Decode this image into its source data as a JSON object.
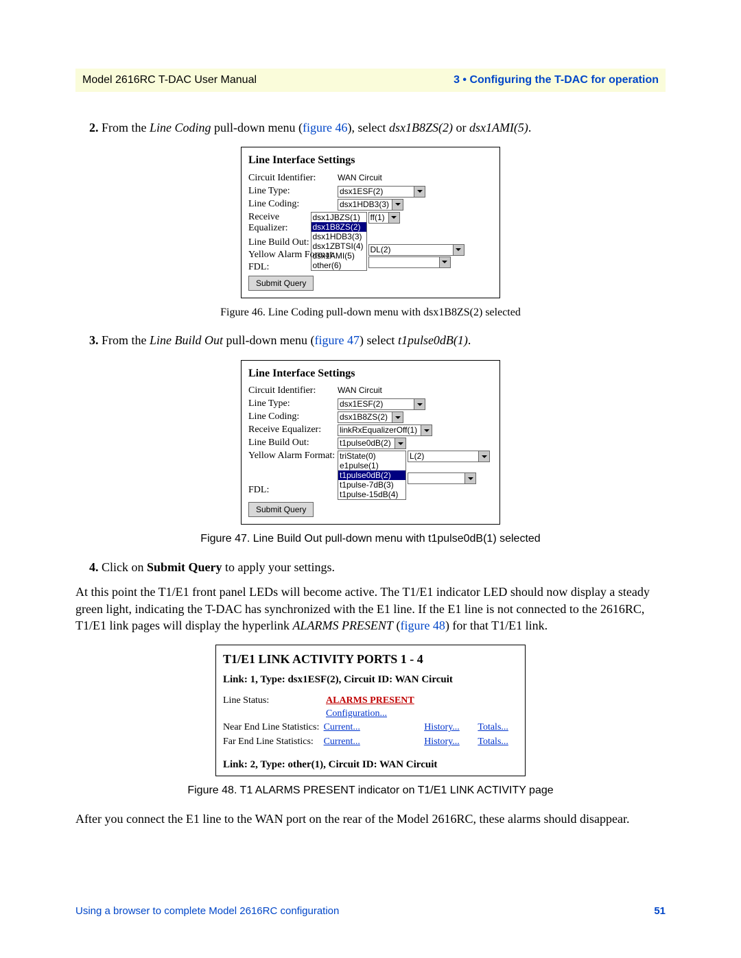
{
  "header": {
    "left": "Model 2616RC T-DAC User Manual",
    "right": "3 • Configuring the T-DAC for operation"
  },
  "steps": {
    "s2_num": "2.",
    "s2_a": "From the ",
    "s2_b": "Line Coding",
    "s2_c": " pull-down menu (",
    "s2_link": "figure 46",
    "s2_d": "), select ",
    "s2_e": "dsx1B8ZS(2)",
    "s2_f": " or ",
    "s2_g": "dsx1AMI(5)",
    "s2_h": ".",
    "s3_num": "3.",
    "s3_a": "From the ",
    "s3_b": "Line Build Out",
    "s3_c": " pull-down menu (",
    "s3_link": "figure 47",
    "s3_d": ") select ",
    "s3_e": "t1pulse0dB(1)",
    "s3_f": ".",
    "s4_num": "4.",
    "s4_a": "Click on ",
    "s4_b": "Submit Query",
    "s4_c": " to apply your settings."
  },
  "fig46_caption": "Figure 46. Line Coding pull-down menu with dsx1B8ZS(2) selected",
  "fig47_caption": "Figure 47. Line Build Out pull-down menu with t1pulse0dB(1) selected",
  "fig48_caption": "Figure 48. T1 ALARMS PRESENT indicator on T1/E1 LINK ACTIVITY page",
  "para1_a": "At this point the T1/E1 front panel LEDs will become active. The T1/E1 indicator LED should now display a steady green light, indicating the T-DAC has synchronized with the E1 line. If the E1 line is not connected to the 2616RC, T1/E1 link pages will display the hyperlink ",
  "para1_b": "ALARMS PRESENT",
  "para1_c": " (",
  "para1_link": "figure 48",
  "para1_d": ") for that T1/E1 link.",
  "para2": "After you connect the E1 line to the WAN port on the rear of the Model 2616RC, these alarms should disappear.",
  "shot_common": {
    "title": "Line Interface Settings",
    "labels": {
      "circuit_id": "Circuit Identifier:",
      "line_type": "Line Type:",
      "line_coding": "Line Coding:",
      "receive_eq": "Receive Equalizer:",
      "line_build_out": "Line Build Out:",
      "yellow_alarm": "Yellow Alarm Format:",
      "fdl": "FDL:"
    },
    "submit": "Submit Query",
    "wan_value": "WAN Circuit"
  },
  "shot1": {
    "line_type": "dsx1ESF(2)",
    "line_coding": "dsx1HDB3(3)",
    "coding_list": [
      "dsx1JBZS(1)",
      "dsx1B8ZS(2)",
      "dsx1HDB3(3)",
      "dsx1ZBTSI(4)",
      "dsx1AMI(5)",
      "other(6)"
    ],
    "re_frag": "ff(1)",
    "yaf_frag": "DL(2)"
  },
  "shot2": {
    "line_type": "dsx1ESF(2)",
    "line_coding": "dsx1B8ZS(2)",
    "receive_eq": "linkRxEqualizerOff(1)",
    "line_build_out": "t1pulse0dB(2)",
    "lbo_list": [
      "triState(0)",
      "e1pulse(1)",
      "t1pulse0dB(2)",
      "t1pulse-7dB(3)",
      "t1pulse-15dB(4)"
    ],
    "yaf_frag": "L(2)"
  },
  "shot3": {
    "title": "T1/E1 LINK ACTIVITY PORTS 1 - 4",
    "link1": "Link: 1, Type: dsx1ESF(2), Circuit ID: WAN Circuit",
    "row_ls": "Line Status:",
    "alarm": "ALARMS PRESENT",
    "config": "Configuration...",
    "row_ne": "Near End Line Statistics:",
    "row_fe": "Far End Line Statistics:",
    "current": "Current...",
    "history": "History...",
    "totals": "Totals...",
    "link2": "Link: 2, Type: other(1), Circuit ID: WAN Circuit"
  },
  "footer": {
    "left": "Using a browser to complete Model 2616RC configuration",
    "right": "51"
  }
}
